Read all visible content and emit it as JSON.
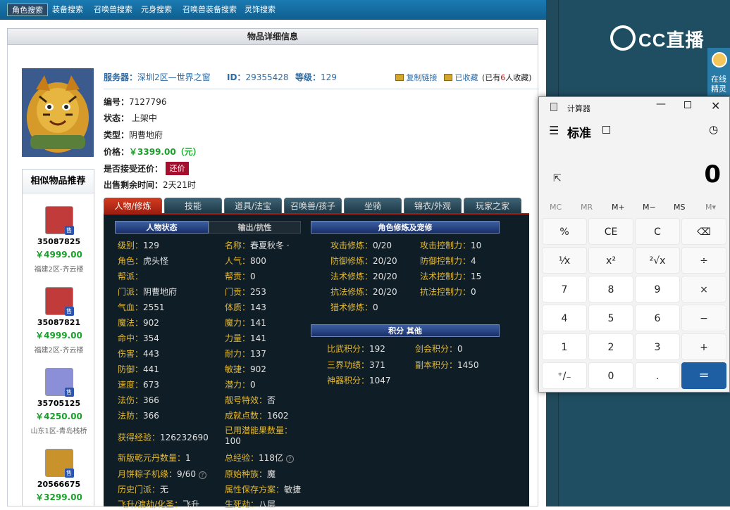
{
  "topnav": {
    "tabs": [
      "角色搜索",
      "装备搜索",
      "召唤兽搜索",
      "元身搜索",
      "召唤兽装备搜索",
      "灵饰搜索"
    ]
  },
  "side": {
    "brand": "CC直播",
    "online_help": "在线精灵"
  },
  "page": {
    "title": "物品详细信息",
    "server_label": "服务器：",
    "server": "深圳2区—世界之窗",
    "id_label": "ID：",
    "id": "29355428",
    "level_label": "等级：",
    "level": "129",
    "copy_link": "复制链接",
    "favorited": "已收藏",
    "fav_count_prefix": "(已有",
    "fav_count": "6",
    "fav_count_suffix": "人收藏)",
    "serial_label": "编号：",
    "serial": "7127796",
    "status_label": "状态：",
    "status": "上架中",
    "type_label": "类型：",
    "type": "阴曹地府",
    "price_label": "价格：",
    "price": "￥3399.00（元）",
    "haggle_label": "是否接受还价：",
    "haggle_btn": "还价",
    "remaining_label": "出售剩余时间：",
    "remaining": "2天21时"
  },
  "similar": {
    "title": "相似物品推荐",
    "sale_badge": "售",
    "items": [
      {
        "id": "35087825",
        "price": "￥4999.00",
        "server": "福建2区-齐云楼"
      },
      {
        "id": "35087821",
        "price": "￥4999.00",
        "server": "福建2区-齐云楼"
      },
      {
        "id": "35705125",
        "price": "￥4250.00",
        "server": "山东1区-青岛栈桥"
      },
      {
        "id": "20566675",
        "price": "￥3299.00",
        "server": ""
      }
    ]
  },
  "tabs": [
    "人物/修炼",
    "技能",
    "道具/法宝",
    "召唤兽/孩子",
    "坐骑",
    "锦衣/外观",
    "玩家之家"
  ],
  "panel": {
    "sec_status": "人物状态",
    "sec_output": "输出/抗性",
    "sec_cultivation": "角色修炼及宠修",
    "sec_points": "积分  其他",
    "left": [
      {
        "k": "级别：",
        "v": "129"
      },
      {
        "k": "角色：",
        "v": "虎头怪"
      },
      {
        "k": "帮派：",
        "v": ""
      },
      {
        "k": "门派：",
        "v": "阴曹地府"
      },
      {
        "k": "气血：",
        "v": "2551"
      },
      {
        "k": "魔法：",
        "v": "902"
      },
      {
        "k": "命中：",
        "v": "354"
      },
      {
        "k": "伤害：",
        "v": "443"
      },
      {
        "k": "防御：",
        "v": "441"
      },
      {
        "k": "速度：",
        "v": "673"
      },
      {
        "k": "法伤：",
        "v": "366"
      },
      {
        "k": "法防：",
        "v": "366"
      }
    ],
    "mid": [
      {
        "k": "名称：",
        "v": "春夏秋冬 ·"
      },
      {
        "k": "人气：",
        "v": "800"
      },
      {
        "k": "帮贡：",
        "v": "0"
      },
      {
        "k": "门贡：",
        "v": "253"
      },
      {
        "k": "体质：",
        "v": "143"
      },
      {
        "k": "魔力：",
        "v": "141"
      },
      {
        "k": "力量：",
        "v": "141"
      },
      {
        "k": "耐力：",
        "v": "137"
      },
      {
        "k": "敏捷：",
        "v": "902"
      },
      {
        "k": "潜力：",
        "v": "0"
      },
      {
        "k": "靓号特效：",
        "v": "否"
      },
      {
        "k": "成就点数：",
        "v": "1602"
      }
    ],
    "exp_label": "获得经验：",
    "exp": "126232690",
    "potential_label": "已用潜能果数量：",
    "potential": "100",
    "bottom": [
      {
        "k": "新版乾元丹数量：",
        "v": "1",
        "k2": "总经验：",
        "v2": "118亿"
      },
      {
        "k": "月饼粽子机缘：",
        "v": "9/60",
        "k2": "原始种族：",
        "v2": "魔"
      },
      {
        "k": "历史门派：",
        "v": "无",
        "k2": "属性保存方案：",
        "v2": "敏捷"
      },
      {
        "k": "飞升/渡劫/化圣：",
        "v": "飞升",
        "k2": "生死劫：",
        "v2": "八层"
      }
    ],
    "cult": [
      {
        "k": "攻击修炼：",
        "v": "0/20",
        "k2": "攻击控制力：",
        "v2": "10"
      },
      {
        "k": "防御修炼：",
        "v": "20/20",
        "k2": "防御控制力：",
        "v2": "4"
      },
      {
        "k": "法术修炼：",
        "v": "20/20",
        "k2": "法术控制力：",
        "v2": "15"
      },
      {
        "k": "抗法修炼：",
        "v": "20/20",
        "k2": "抗法控制力：",
        "v2": "0"
      },
      {
        "k": "猎术修炼：",
        "v": "0",
        "k2": "",
        "v2": ""
      }
    ],
    "points": [
      {
        "k": "比武积分：",
        "v": "192",
        "k2": "剑会积分：",
        "v2": "0"
      },
      {
        "k": "三界功绩：",
        "v": "371",
        "k2": "副本积分：",
        "v2": "1450"
      },
      {
        "k": "神器积分：",
        "v": "1047",
        "k2": "",
        "v2": ""
      }
    ]
  },
  "calc": {
    "title": "计算器",
    "mode": "标准",
    "display": "0",
    "memory": [
      "MC",
      "MR",
      "M+",
      "M−",
      "MS",
      "M▾"
    ],
    "keys": [
      "%",
      "CE",
      "C",
      "⌫",
      "¹⁄x",
      "x²",
      "²√x",
      "÷",
      "7",
      "8",
      "9",
      "×",
      "4",
      "5",
      "6",
      "−",
      "1",
      "2",
      "3",
      "+",
      "⁺/₋",
      "0",
      ".",
      "="
    ]
  }
}
